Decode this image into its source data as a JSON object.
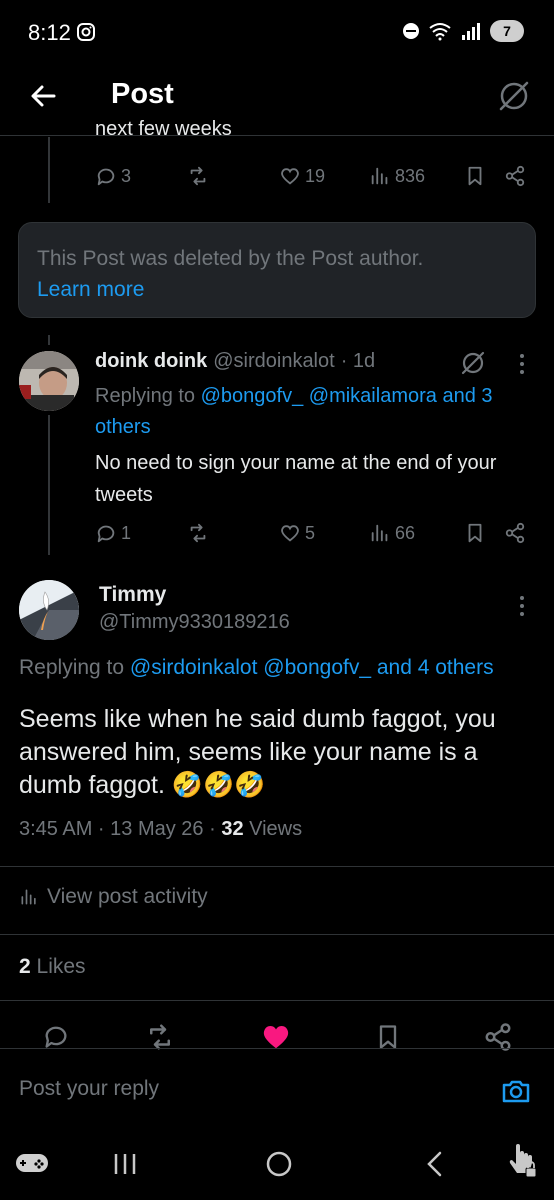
{
  "status_bar": {
    "time": "8:12",
    "battery": "7"
  },
  "header": {
    "title": "Post"
  },
  "prev_post": {
    "cut_text": "next few weeks",
    "replies": "3",
    "likes": "19",
    "views": "836"
  },
  "deleted_notice": {
    "text": "This Post was deleted by the Post author.",
    "link": "Learn more"
  },
  "reply": {
    "name": "doink doink",
    "handle": "@sirdoinkalot",
    "time": "· 1d",
    "replying_prefix": "Replying to",
    "replying_handles": "@bongofv_ @mikailamora and 3 others",
    "text": "No need to sign your name at the end of your tweets",
    "replies": "1",
    "likes": "5",
    "views": "66"
  },
  "main_post": {
    "name": "Timmy",
    "handle": "@Timmy9330189216",
    "replying_prefix": "Replying to",
    "replying_handles": "@sirdoinkalot @bongofv_ and 4 others",
    "text": "Seems like when he said dumb faggot, you answered him, seems like your name is a dumb faggot. 🤣🤣🤣",
    "timestamp": "3:45 AM · 13 May 26 · ",
    "views_count": "32",
    "views_label": " Views",
    "view_activity": "View post activity",
    "likes_count": "2",
    "likes_label": " Likes"
  },
  "composer": {
    "placeholder": "Post your reply"
  },
  "colors": {
    "accent": "#1d9bf0",
    "like": "#f91880",
    "muted": "#71767b"
  }
}
